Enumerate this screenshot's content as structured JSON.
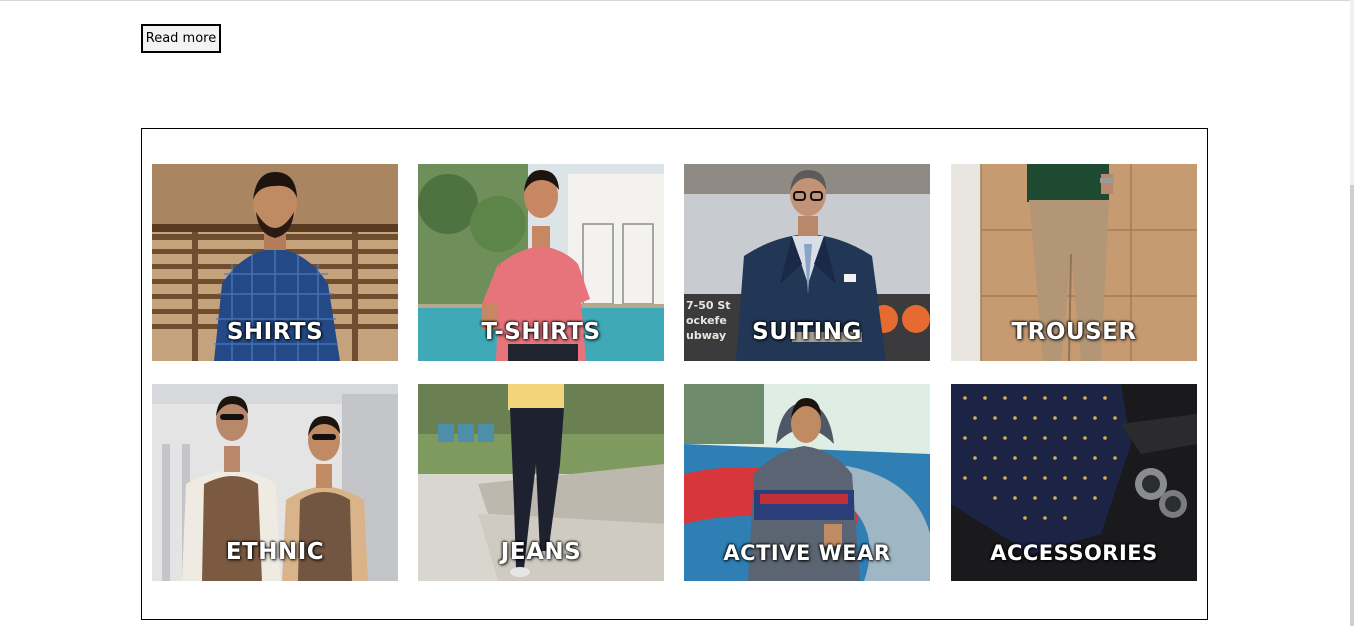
{
  "read_more_label": "Read more",
  "categories": [
    {
      "label": "SHIRTS",
      "icon": "man-in-blue-check-shirt"
    },
    {
      "label": "T-SHIRTS",
      "icon": "man-in-pink-polo"
    },
    {
      "label": "SUITING",
      "icon": "man-in-navy-suit"
    },
    {
      "label": "TROUSER",
      "icon": "khaki-trousers"
    },
    {
      "label": "ETHNIC",
      "icon": "men-in-waistcoats"
    },
    {
      "label": "JEANS",
      "icon": "man-in-jeans"
    },
    {
      "label": "ACTIVE WEAR",
      "icon": "man-in-hoodie"
    },
    {
      "label": "ACCESSORIES",
      "icon": "tie-and-cufflinks"
    }
  ],
  "colors": {
    "frame_border": "#000000",
    "label_text": "#ffffff",
    "button_bg": "#f3f3f3"
  }
}
